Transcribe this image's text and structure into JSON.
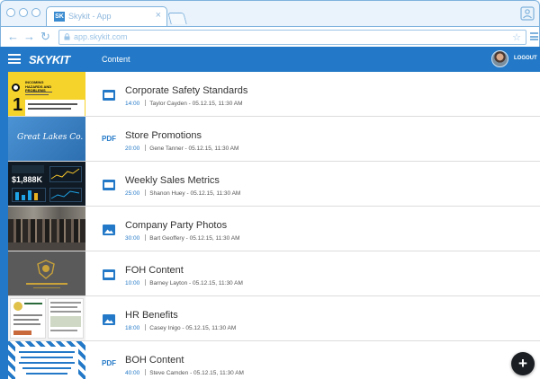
{
  "browser": {
    "tab_title": "Skykit - App",
    "tab_logo": "SK",
    "tab_close": "×",
    "url": "app.skykit.com",
    "back_icon": "←",
    "forward_icon": "→",
    "reload_icon": "↻",
    "star_icon": "☆"
  },
  "header": {
    "brand": "SKYKIT",
    "section": "Content",
    "logout": "LOGOUT"
  },
  "items": [
    {
      "title": "Corporate Safety Standards",
      "duration": "14:00",
      "meta": "Taylor Cayden - 05.12.15, 11:30 AM",
      "type": "video-icon"
    },
    {
      "title": "Store Promotions",
      "duration": "20:00",
      "meta": "Gene Tanner - 05.12.15, 11:30 AM",
      "type": "pdf-label",
      "type_label": "PDF"
    },
    {
      "title": "Weekly Sales Metrics",
      "duration": "25:00",
      "meta": "Shanon Huey - 05.12.15, 11:30 AM",
      "type": "video-icon"
    },
    {
      "title": "Company Party Photos",
      "duration": "30:00",
      "meta": "Bart Geoffery - 05.12.15, 11:30 AM",
      "type": "image-icon"
    },
    {
      "title": "FOH Content",
      "duration": "10:00",
      "meta": "Barney Layton - 05.12.15, 11:30 AM",
      "type": "video-icon"
    },
    {
      "title": "HR Benefits",
      "duration": "18:00",
      "meta": "Casey Inigo - 05.12.15, 11:30 AM",
      "type": "image-icon"
    },
    {
      "title": "BOH Content",
      "duration": "40:00",
      "meta": "Steve Camden - 05.12.15, 11:30 AM",
      "type": "pdf-label",
      "type_label": "PDF"
    }
  ],
  "thumbs": {
    "safety_heading": "INCOMING HAZARDS AND PROBLEMS",
    "safety_number": "1",
    "great_lakes": "Great Lakes Co.",
    "sales_value": "$1,888K"
  },
  "fab_label": "+",
  "colors": {
    "brand_blue": "#2379c7",
    "safety_yellow": "#f6d32b",
    "great_lakes_blue": "#3a82c6",
    "gold": "#c9a23a"
  }
}
